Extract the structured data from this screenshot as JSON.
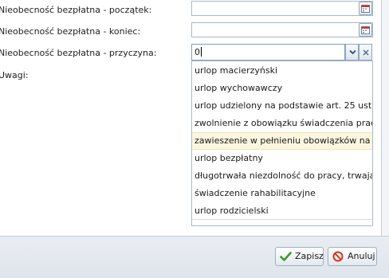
{
  "form": {
    "labels": {
      "start": "Nieobecność bezpłatna - początek:",
      "end": "Nieobecność bezpłatna - koniec:",
      "reason": "Nieobecność bezpłatna - przyczyna:",
      "notes": "Uwagi:"
    },
    "reason_value": "0"
  },
  "dropdown": {
    "items": [
      "urlop macierzyński",
      "urlop wychowawczy",
      "urlop udzielony na podstawie art. 25 ust",
      "zwolnienie z obowiązku świadczenia prac",
      "zawieszenie w pełnieniu obowiązków na",
      "urlop bezpłatny",
      "długotrwała niezdolność do pracy, trwają",
      "świadczenie rahabilitacyjne",
      "urlop rodzicielski"
    ],
    "highlighted_index": 4
  },
  "footer": {
    "save_label": "Zapisz",
    "cancel_label": "Anuluj"
  },
  "icons": {
    "date_picker": "calendar-icon",
    "dropdown": "chevron-down-icon",
    "clear": "close-icon",
    "save": "checkmark-icon",
    "cancel": "forbidden-icon"
  },
  "colors": {
    "save_icon": "#3a9a2a",
    "cancel_icon": "#d23a1e",
    "highlight": "#fbf6df"
  }
}
